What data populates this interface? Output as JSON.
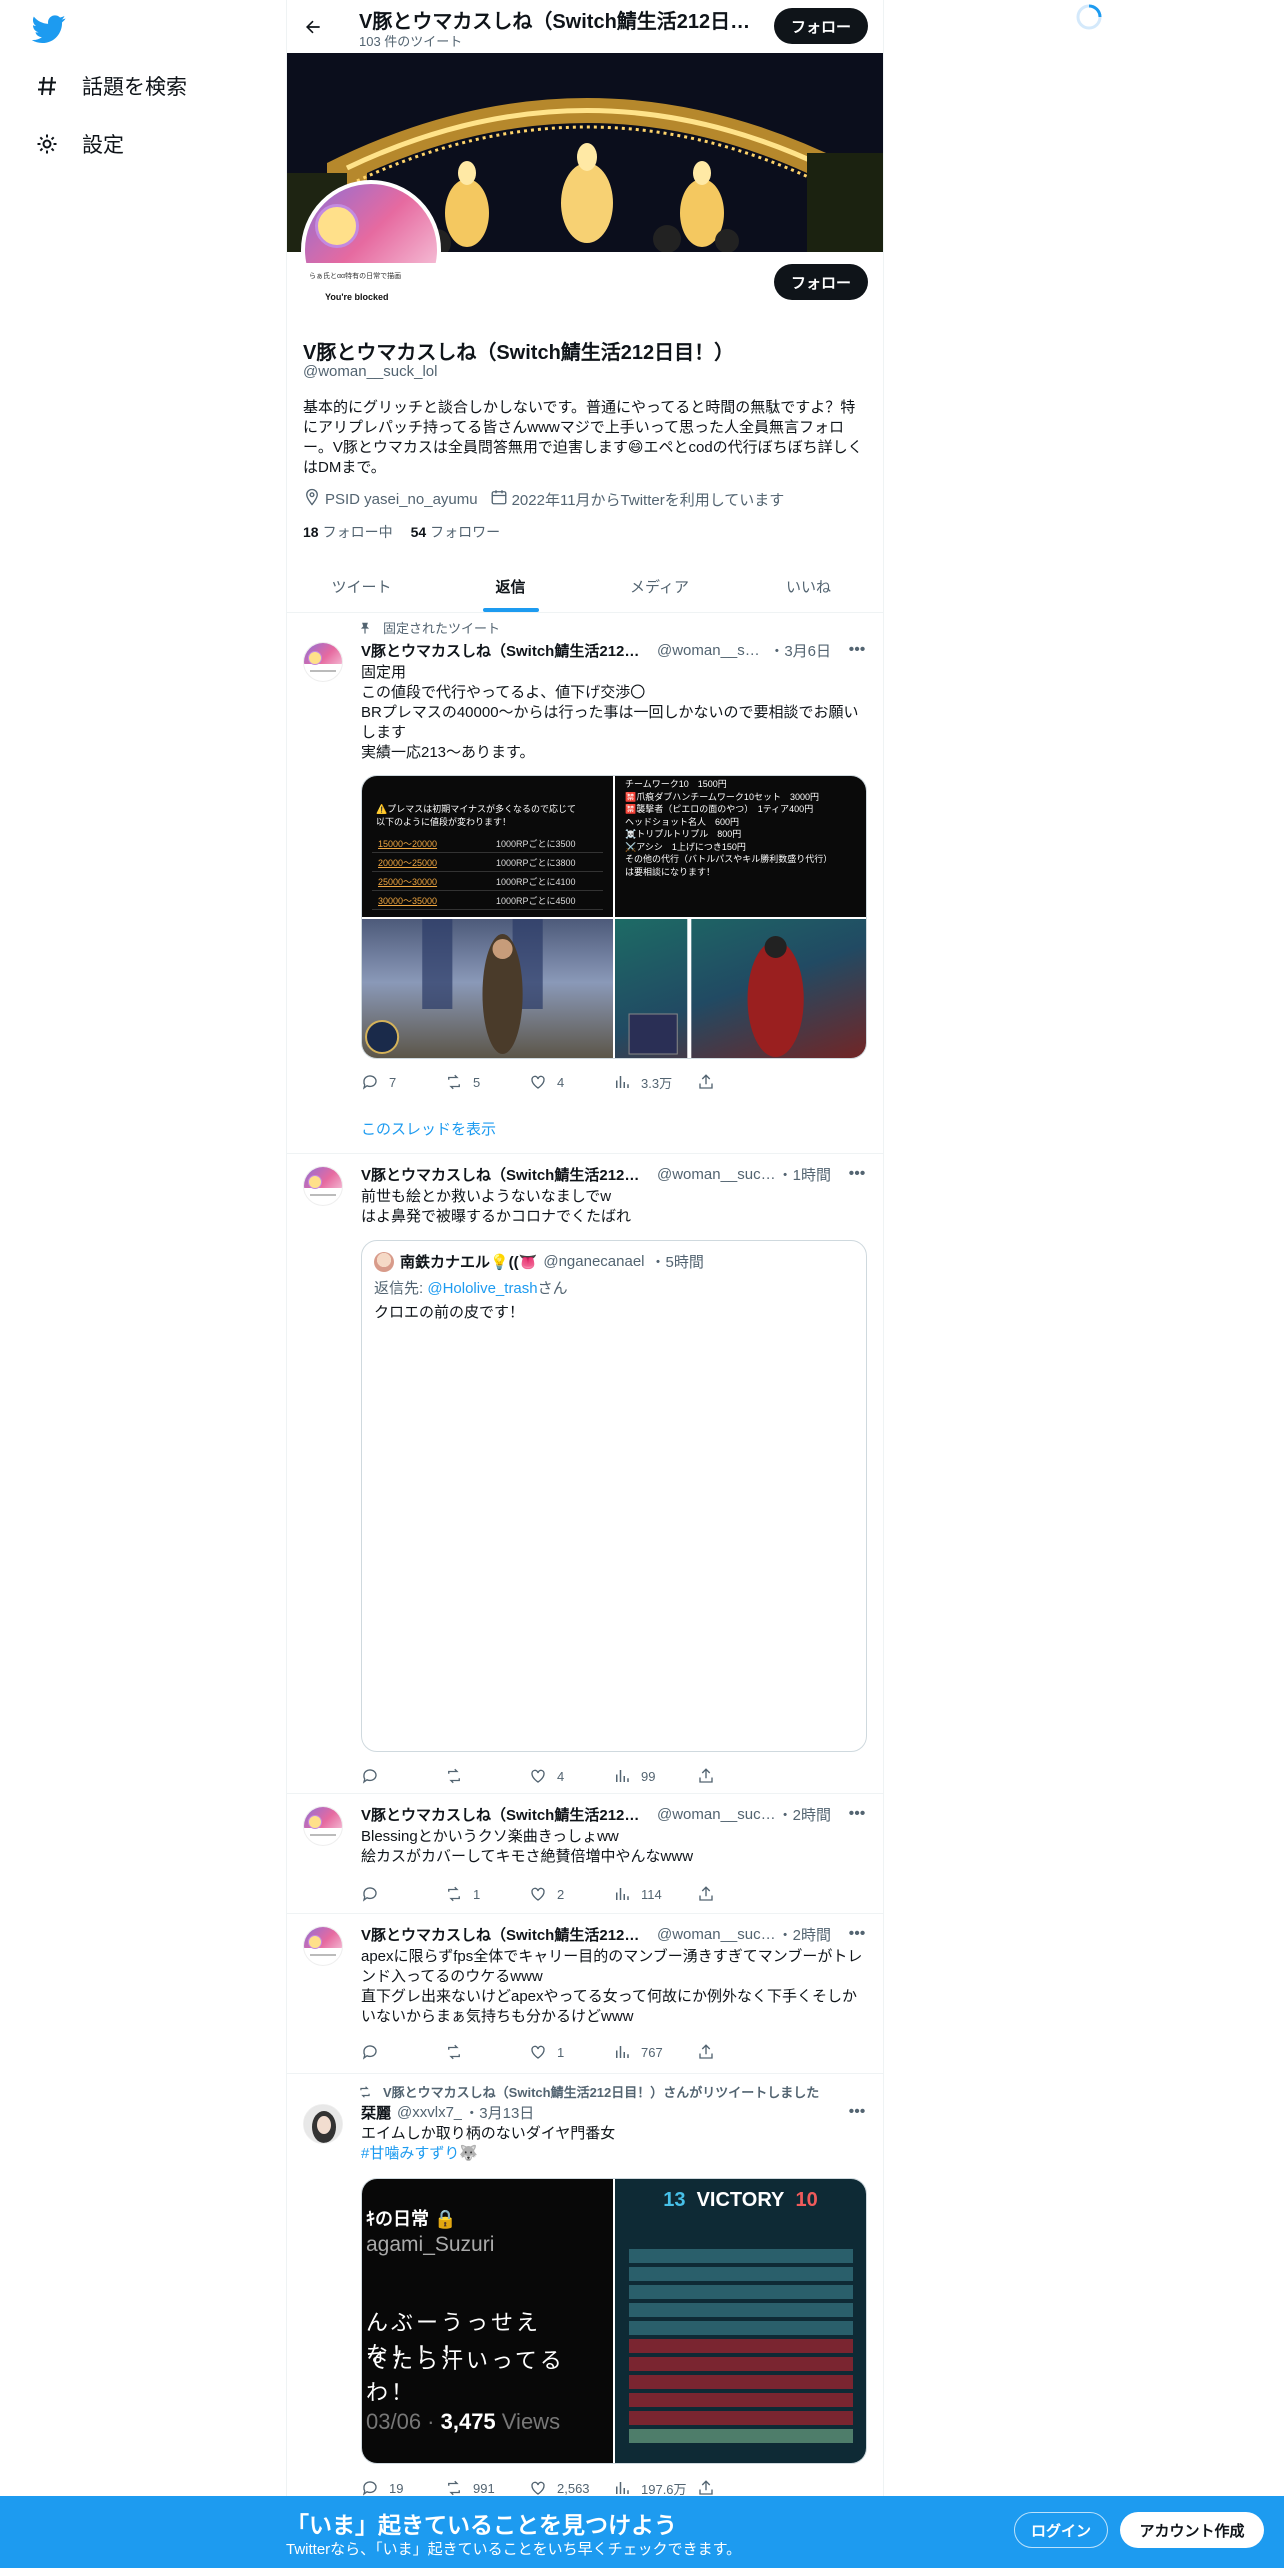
{
  "nav": {
    "explore_label": "話題を検索",
    "settings_label": "設定"
  },
  "topbar": {
    "title": "V豚とウマカスしね（Switch鯖生活212日目！）",
    "tweet_count": "103 件のツイート",
    "follow_label": "フォロー"
  },
  "profile": {
    "avatar_line1": "らぁ氏とαα特有の日常で描画",
    "avatar_line2": "You're blocked",
    "follow_label": "フォロー",
    "name": "V豚とウマカスしね（Switch鯖生活212日目！）",
    "handle": "@woman__suck_lol",
    "bio": "基本的にグリッチと談合しかしないです。普通にやってると時間の無駄ですよ？持ってる皆さんwwwマジで上手いって思った人全員無言フォロー。V豚とウマカスは全員問答無用で迫害します😄エペとcodの代行ぼちぼち詳しくはDMまで。",
    "bio_prefix": "基本的にグリッチと談合しかしないです。普通にやってると時間の無駄ですよ？特にアリプレパッチ持ってる皆さんwwwマジで上手いって思った人全員無言フォロー。V豚とウマカスは全員問答無用で迫害します😄エペとcodの代行ぼちぼち詳しくはDMまで。",
    "location": "PSID yasei_no_ayumu",
    "joined": "2022年11月からTwitterを利用しています",
    "following_count": "18",
    "following_label": "フォロー中",
    "followers_count": "54",
    "followers_label": "フォロワー"
  },
  "tabs": [
    "ツイート",
    "返信",
    "メディア",
    "いいね"
  ],
  "tweets": [
    {
      "pinned_label": "固定されたツイート",
      "name": "V豚とウマカスしね（Switch鯖生活212日目！）",
      "handle": "@woman__suck_lol",
      "time": "・3月6日",
      "text": "固定用\nこの値段で代行やってるよ、値下げ交渉〇\nBRプレマスの40000〜からは行った事は一回しかないので要相談でお願いします\n実績一応213〜あります。",
      "media": {
        "rates_warning": "⚠️プレマスは初期マイナスが多くなるので応じて\n以下のように値段が変わります！",
        "rates": [
          {
            "range": "15000〜20000",
            "price": "1000RPごとに3500"
          },
          {
            "range": "20000〜25000",
            "price": "1000RPごとに3800"
          },
          {
            "range": "25000〜30000",
            "price": "1000RPごとに4100"
          },
          {
            "range": "30000〜35000",
            "price": "1000RPごとに4500"
          }
        ],
        "services": [
          "チームワーク10　1500円",
          "🈲爪痕ダブハンチームワーク10セット　3000円",
          "🈲襲撃者（ピエロの面のやつ）　1ティア400円",
          "ヘッドショット名人　600円",
          "☠️トリプルトリプル　800円",
          "⚔️アシシ　1上げにつき150円",
          "その他の代行（バトルパスやキル勝利数盛り代行）",
          "は要相談になります！"
        ]
      },
      "replies": "7",
      "retweets": "5",
      "likes": "4",
      "views": "3.3万",
      "thread_label": "このスレッドを表示"
    },
    {
      "name": "V豚とウマカスしね（Switch鯖生活212日目！）",
      "handle": "@woman__suck_lol",
      "time": "・1時間",
      "text": "前世も絵とか救いようないなましでw\nはよ鼻発で被曝するかコロナでくたばれ",
      "quote": {
        "name": "南鉄カナエル💡((👅",
        "handle": "@nganecanael",
        "time": "・5時間",
        "reply_prefix": "返信先: ",
        "reply_to": "@Hololive_trash",
        "reply_suffix": "さん",
        "text": "クロエの前の皮です！"
      },
      "replies": "",
      "retweets": "",
      "likes": "4",
      "views": "99"
    },
    {
      "name": "V豚とウマカスしね（Switch鯖生活212日目！）",
      "handle": "@woman__suck_lol",
      "time": "・2時間",
      "text": "Blessingとかいうクソ楽曲きっしょww\n絵カスがカバーしてキモさ絶賛倍増中やんなwww",
      "replies": "",
      "retweets": "1",
      "likes": "2",
      "views": "114"
    },
    {
      "name": "V豚とウマカスしね（Switch鯖生活212日目！）",
      "handle": "@woman__suck_lol",
      "time": "・2時間",
      "text": "apexに限らずfps全体でキャリー目的のマンブー湧きすぎてマンブーがトレンド入ってるのウケるwww\n直下グレ出来ないけどapexやってる女って何故にか例外なく下手くそしかいないからまぁ気持ちも分かるけどwww",
      "replies": "",
      "retweets": "",
      "likes": "1",
      "views": "767"
    },
    {
      "retweet_label": "V豚とウマカスしね（Switch鯖生活212日目！）さんがリツイートしました",
      "name": "栞麗",
      "handle": "@xxvlx7_",
      "time": "・3月13日",
      "text": "エイムしか取り柄のないダイヤ門番女",
      "hashtag": "#甘噛みすずり🐺",
      "stream": {
        "line1": "ｷの日常 🔒",
        "line2": "agami_Suzuri",
        "line3": "んぶーうっせえな！！！",
        "line4": "てたら汗いってるわ！",
        "views_date": "03/06 · ",
        "views_count": "3,475",
        "views_label": " Views"
      },
      "victory": {
        "left": "13",
        "word": "VICTORY",
        "right": "10"
      },
      "replies": "19",
      "retweets": "991",
      "likes": "2,563",
      "views": "197.6万"
    }
  ],
  "bottombar": {
    "title": "「いま」起きていることを見つけよう",
    "subtitle": "Twitterなら、「いま」起きていることをいち早くチェックできます。",
    "login_label": "ログイン",
    "signup_label": "アカウント作成"
  },
  "colors": {
    "accent": "#1d9bf0",
    "text": "#0f1419",
    "secondary": "#536471",
    "follow_button": "#0f1419"
  },
  "icons": [
    "twitter-logo-icon",
    "hashtag-icon",
    "gear-icon",
    "back-arrow-icon",
    "pin-icon",
    "retweet-icon",
    "reply-icon",
    "like-icon",
    "views-icon",
    "share-icon",
    "location-icon",
    "calendar-icon",
    "more-icon"
  ]
}
